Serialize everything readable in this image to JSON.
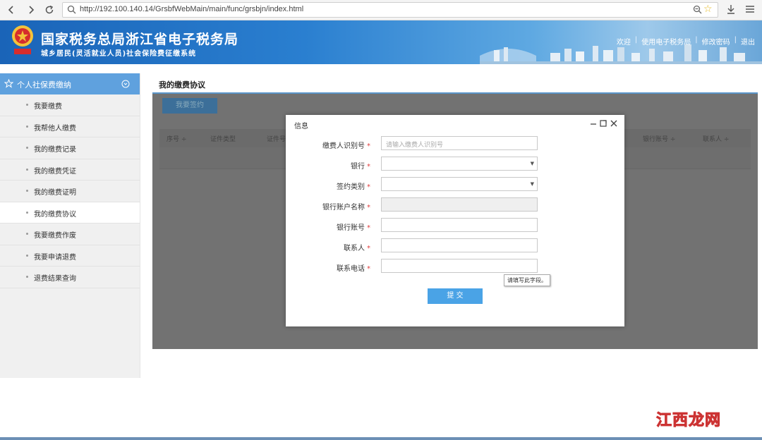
{
  "browser": {
    "url": "http://192.100.140.14/GrsbfWebMain/main/func/grsbjn/index.html"
  },
  "header": {
    "title": "国家税务总局浙江省电子税务局",
    "subtitle": "城乡居民(灵活就业人员)社会保险费征缴系统",
    "links": [
      "欢迎",
      "使用电子税务局",
      "修改密码",
      "退出"
    ]
  },
  "sidebar": {
    "section_label": "个人社保费缴纳",
    "items": [
      {
        "label": "我要缴费"
      },
      {
        "label": "我帮他人缴费"
      },
      {
        "label": "我的缴费记录"
      },
      {
        "label": "我的缴费凭证"
      },
      {
        "label": "我的缴费证明"
      },
      {
        "label": "我的缴费协议"
      },
      {
        "label": "我要缴费作废"
      },
      {
        "label": "我要申请退费"
      },
      {
        "label": "退费结果查询"
      }
    ],
    "active_index": 5
  },
  "main": {
    "page_title": "我的缴费协议",
    "sign_button": "我要签约",
    "table_headers": [
      "序号 ÷",
      "证件类型",
      "证件号",
      "银行账号 ÷",
      "联系人 ÷"
    ]
  },
  "modal": {
    "title": "信息",
    "fields": [
      {
        "label": "缴费人识别号",
        "placeholder": "请输入缴费人识别号",
        "type": "text"
      },
      {
        "label": "银行",
        "type": "select"
      },
      {
        "label": "签约类别",
        "type": "select"
      },
      {
        "label": "银行账户名称",
        "type": "disabled"
      },
      {
        "label": "银行账号",
        "type": "text"
      },
      {
        "label": "联系人",
        "type": "text"
      },
      {
        "label": "联系电话",
        "type": "text"
      }
    ],
    "required_mark": "*",
    "tooltip": "请填写此字段。",
    "submit_label": "提 交"
  },
  "watermark": "江西龙网",
  "colors": {
    "banner": "#2a7fd0",
    "sidebar_head": "#5fa1de",
    "submit": "#4aa3e6",
    "overlay": "#727272"
  }
}
